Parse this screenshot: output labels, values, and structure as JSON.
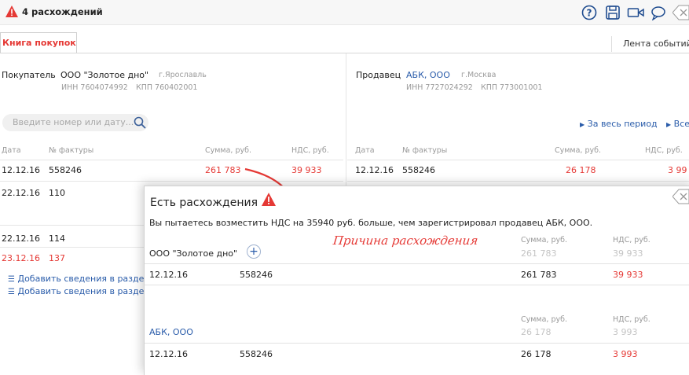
{
  "header": {
    "title": "4 расхождений",
    "icons": [
      "help-icon",
      "save-icon",
      "video-icon",
      "comment-icon",
      "close-icon"
    ]
  },
  "tabs": {
    "purchases": "Книга покупок",
    "events": "Лента событий"
  },
  "buyer": {
    "label": "Покупатель",
    "name": "ООО \"Золотое дно\"",
    "city": "г.Ярославль",
    "inn": "ИНН 7604074992",
    "kpp": "КПП 760402001"
  },
  "seller": {
    "label": "Продавец",
    "name": "АБК, ООО",
    "city": "г.Москва",
    "inn": "ИНН 7727024292",
    "kpp": "КПП 773001001"
  },
  "search": {
    "placeholder": "Введите номер или дату..."
  },
  "filters": {
    "whole_period": "За весь период",
    "all": "Все"
  },
  "table_left": {
    "headers": {
      "date": "Дата",
      "number": "№ фактуры",
      "sum": "Сумма, руб.",
      "vat": "НДС, руб."
    },
    "rows": [
      {
        "date": "12.12.16",
        "number": "558246",
        "sum": "261 783",
        "vat": "39 933"
      },
      {
        "date": "22.12.16",
        "number": "110"
      },
      {
        "date": "22.12.16",
        "number": "114"
      },
      {
        "date": "23.12.16",
        "number": "137"
      }
    ]
  },
  "table_right": {
    "headers": {
      "date": "Дата",
      "number": "№ фактуры",
      "sum": "Сумма, руб.",
      "vat": "НДС, руб."
    },
    "rows": [
      {
        "date": "12.12.16",
        "number": "558246",
        "sum": "26 178",
        "vat": "3 99"
      }
    ]
  },
  "add_links": [
    "Добавить сведения в разде",
    "Добавить сведения в разде"
  ],
  "popup": {
    "title": "Есть расхождения",
    "message": "Вы пытаетесь возместить НДС на 35940 руб. больше, чем зарегистрировал продавец АБК, ООО.",
    "annotation": "Причина расхождения",
    "buyer_block": {
      "name": "ООО \"Золотое дно\"",
      "sum_label": "Сумма, руб.",
      "vat_label": "НДС, руб.",
      "sum_total": "261 783",
      "vat_total": "39 933",
      "row": {
        "date": "12.12.16",
        "number": "558246",
        "sum": "261 783",
        "vat": "39 933"
      }
    },
    "seller_block": {
      "name": "АБК, ООО",
      "sum_label": "Сумма, руб.",
      "vat_label": "НДС, руб.",
      "sum_total": "26 178",
      "vat_total": "3 993",
      "row": {
        "date": "12.12.16",
        "number": "558246",
        "sum": "26 178",
        "vat": "3 993"
      }
    }
  },
  "colors": {
    "accent_red": "#e53935",
    "link_blue": "#2a5caa"
  }
}
